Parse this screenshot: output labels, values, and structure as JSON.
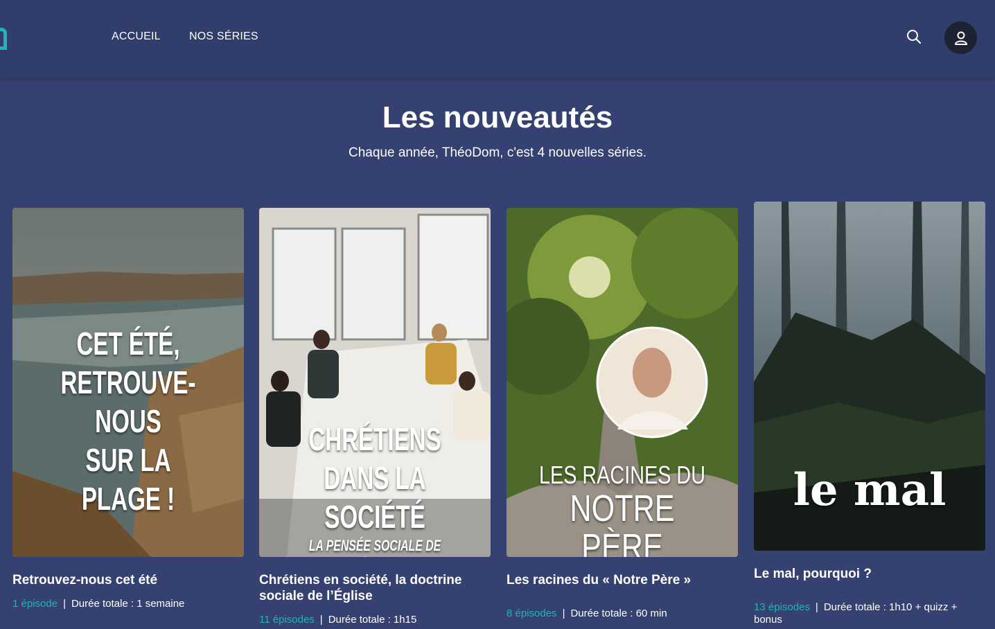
{
  "header": {
    "nav": [
      {
        "label": "ACCUEIL"
      },
      {
        "label": "NOS SÉRIES"
      }
    ],
    "search_icon": "search-icon",
    "account_icon": "user-icon"
  },
  "section": {
    "title": "Les nouveautés",
    "subtitle": "Chaque année, ThéoDom, c'est 4 nouvelles séries."
  },
  "cards": [
    {
      "overlay_lines": [
        "CET ÉTÉ,",
        "RETROUVE-NOUS",
        "SUR LA PLAGE !"
      ],
      "title": "Retrouvez-nous cet été",
      "episodes": "1 épisode",
      "duration": "Durée totale : 1 semaine"
    },
    {
      "overlay_lines": [
        "CHRÉTIENS",
        "DANS LA SOCIÉTÉ",
        "LA PENSÉE SOCIALE DE L'ÉGLISE"
      ],
      "title": "Chrétiens en société, la doctrine sociale de l’Église",
      "episodes": "11 épisodes",
      "duration": "Durée totale : 1h15"
    },
    {
      "overlay_lines": [
        "LES RACINES DU",
        "NOTRE PÈRE"
      ],
      "title": "Les racines du « Notre Père »",
      "episodes": "8 épisodes",
      "duration": "Durée totale : 60 min"
    },
    {
      "overlay_lines": [
        "le mal"
      ],
      "title": "Le mal, pourquoi ?",
      "episodes": "13 épisodes",
      "duration": "Durée totale : 1h10 + quizz + bonus"
    }
  ],
  "colors": {
    "background": "#354170",
    "header": "#313d6b",
    "accent": "#1fb6b2"
  }
}
